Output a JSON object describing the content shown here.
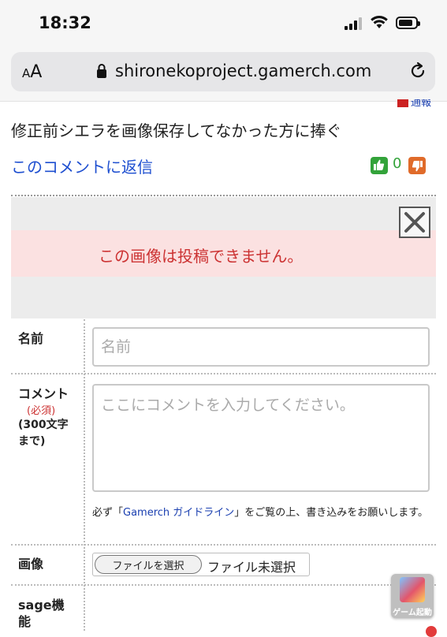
{
  "status_bar": {
    "time": "18:32"
  },
  "browser": {
    "text_size_label": "AA",
    "url": "shironekoproject.gamerch.com"
  },
  "comment": {
    "report_label": "通報",
    "body": "修正前シエラを画像保存してなかった方に捧ぐ",
    "reply_link": "このコメントに返信",
    "good_count": "0"
  },
  "error": {
    "message": "この画像は投稿できません。"
  },
  "form": {
    "name_label": "名前",
    "name_placeholder": "名前",
    "comment_label": "コメント",
    "required_label": "(必須)",
    "limit_label_line1": "(300文字",
    "limit_label_line2": "まで)",
    "comment_placeholder": "ここにコメントを入力してください。",
    "guide_prefix": "必ず「",
    "guide_link": "Gamerch ガイドライン",
    "guide_suffix": "」をご覧の上、書き込みをお願いします。",
    "image_label": "画像",
    "file_button": "ファイルを選択",
    "file_status": "ファイル未選択",
    "sage_label_line1": "sage機",
    "sage_label_line2": "能"
  },
  "game_launch": {
    "label": "ゲーム起動"
  },
  "colors": {
    "link": "#1e4fd0",
    "error": "#cc3333",
    "good": "#33a33a",
    "bad": "#e06b2a"
  }
}
